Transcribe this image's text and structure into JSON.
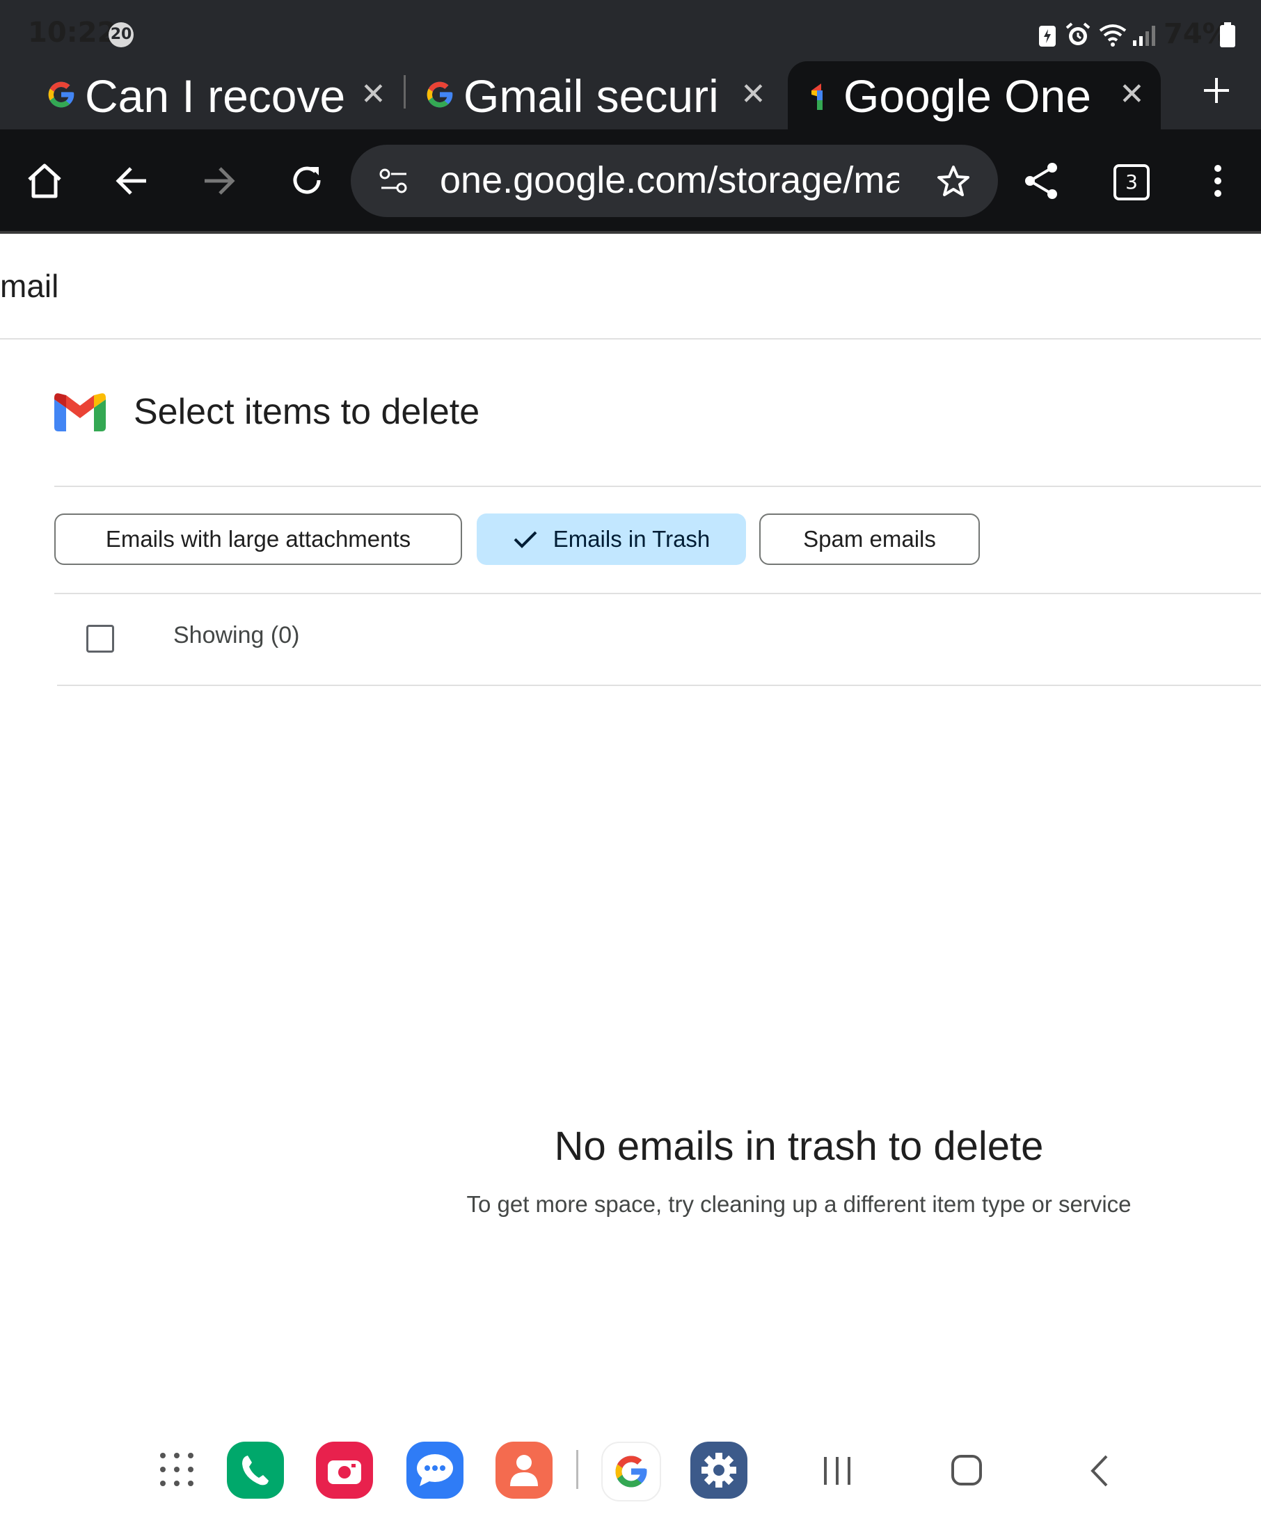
{
  "status_bar": {
    "time": "10:22",
    "notification_count": "20",
    "battery": "74%"
  },
  "tabs": [
    {
      "title": "Can I recove",
      "icon": "google-g-icon"
    },
    {
      "title": "Gmail securi",
      "icon": "google-g-icon"
    },
    {
      "title": "Google One",
      "icon": "google-one-icon",
      "active": true
    }
  ],
  "toolbar": {
    "url": "one.google.com/storage/mai",
    "tab_count": "3"
  },
  "page": {
    "header_text": "mail",
    "section_title": "Select items to delete",
    "chips": [
      {
        "label": "Emails with large attachments",
        "selected": false
      },
      {
        "label": "Emails in Trash",
        "selected": true
      },
      {
        "label": "Spam emails",
        "selected": false
      }
    ],
    "showing": "Showing (0)",
    "empty_title": "No emails in trash to delete",
    "empty_subtitle": "To get more space, try cleaning up a different item type or service"
  },
  "dock": {
    "apps": [
      "app-drawer-icon",
      "phone-icon",
      "camera-icon",
      "messages-icon",
      "contacts-icon",
      "google-icon",
      "settings-icon"
    ],
    "nav": [
      "recents-icon",
      "home-icon",
      "back-icon"
    ]
  },
  "colors": {
    "chrome_dark": "#27292d",
    "toolbar_dark": "#111214",
    "chip_selected": "#c2e7ff"
  }
}
